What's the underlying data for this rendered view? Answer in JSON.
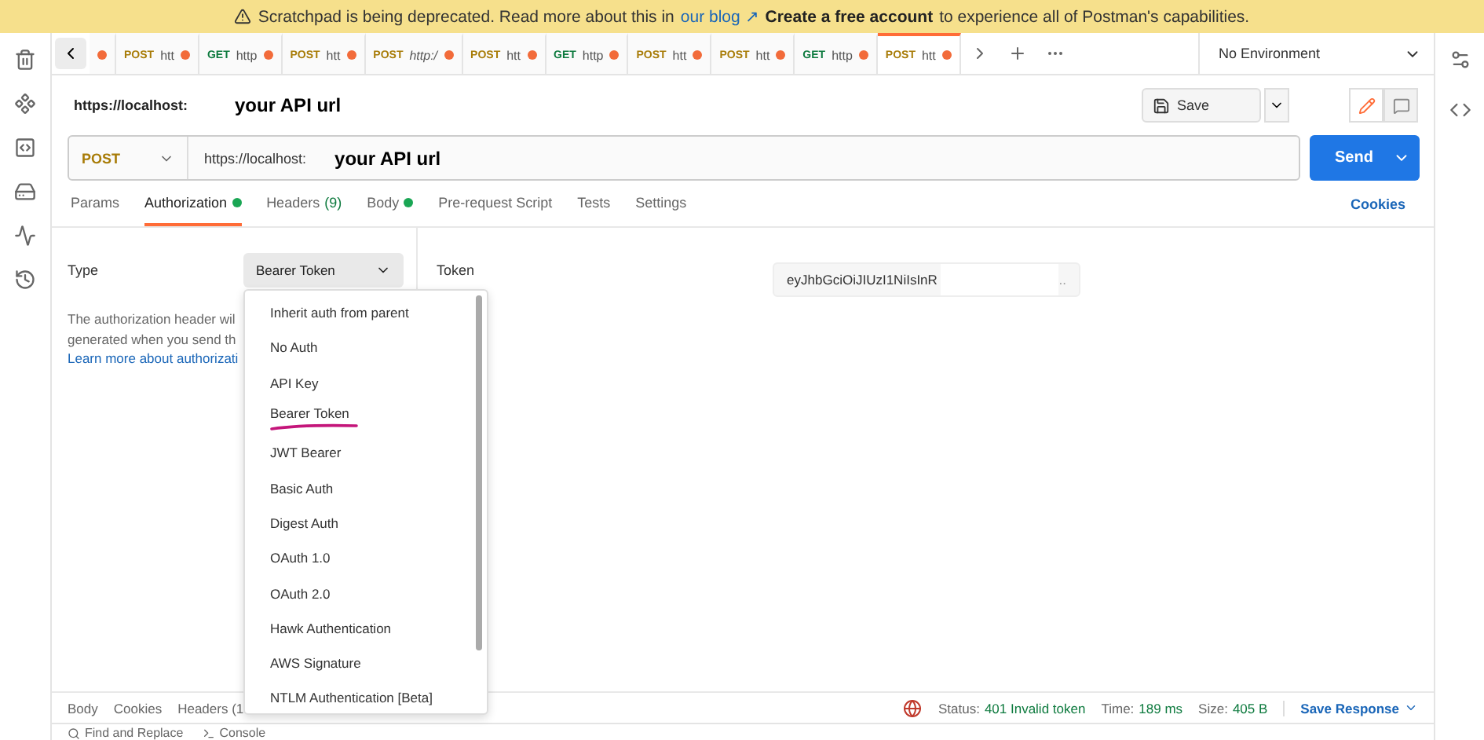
{
  "banner": {
    "text": "Scratchpad is being deprecated. Read more about this in",
    "link": "our blog ↗",
    "cta": "Create a free account",
    "rest": "to experience all of Postman's capabilities."
  },
  "tabs": [
    {
      "method": "POST",
      "label": "htt",
      "preview": false,
      "selected": false
    },
    {
      "method": "GET",
      "label": "http",
      "preview": false,
      "selected": false
    },
    {
      "method": "POST",
      "label": "htt",
      "preview": false,
      "selected": false
    },
    {
      "method": "POST",
      "label": "http:/",
      "preview": true,
      "selected": false
    },
    {
      "method": "POST",
      "label": "htt",
      "preview": false,
      "selected": false
    },
    {
      "method": "GET",
      "label": "http",
      "preview": false,
      "selected": false
    },
    {
      "method": "POST",
      "label": "htt",
      "preview": false,
      "selected": false
    },
    {
      "method": "POST",
      "label": "htt",
      "preview": false,
      "selected": false
    },
    {
      "method": "GET",
      "label": "http",
      "preview": false,
      "selected": false
    },
    {
      "method": "POST",
      "label": "htt",
      "preview": false,
      "selected": true
    }
  ],
  "environment": "No Environment",
  "request": {
    "name": "https://localhost:",
    "name_note": "your API url",
    "save": "Save",
    "method": "POST",
    "url": "https://localhost:",
    "url_note": "your API url",
    "send": "Send"
  },
  "request_tabs": [
    {
      "label": "Params",
      "dot": false,
      "selected": false
    },
    {
      "label": "Authorization",
      "dot": true,
      "selected": true
    },
    {
      "label": "Headers",
      "dot": false,
      "count": "(9)",
      "selected": false
    },
    {
      "label": "Body",
      "dot": true,
      "selected": false
    },
    {
      "label": "Pre-request Script",
      "dot": false,
      "selected": false
    },
    {
      "label": "Tests",
      "dot": false,
      "selected": false
    },
    {
      "label": "Settings",
      "dot": false,
      "selected": false
    }
  ],
  "cookies": "Cookies",
  "auth": {
    "type_label": "Type",
    "type_value": "Bearer Token",
    "help_1": "The authorization header wil",
    "help_2": "generated when you send th",
    "learn": "Learn more about authorizati",
    "token_label": "Token",
    "token_value": "eyJhbGciOiJIUzI1NiIsInR",
    "token_more": ".."
  },
  "dropdown": [
    {
      "label": "Inherit auth from parent",
      "marked": false
    },
    {
      "label": "No Auth",
      "marked": false
    },
    {
      "label": "API Key",
      "marked": false
    },
    {
      "label": "Bearer Token",
      "marked": true
    },
    {
      "label": "JWT Bearer",
      "marked": false
    },
    {
      "label": "Basic Auth",
      "marked": false
    },
    {
      "label": "Digest Auth",
      "marked": false
    },
    {
      "label": "OAuth 1.0",
      "marked": false
    },
    {
      "label": "OAuth 2.0",
      "marked": false
    },
    {
      "label": "Hawk Authentication",
      "marked": false
    },
    {
      "label": "AWS Signature",
      "marked": false
    },
    {
      "label": "NTLM Authentication [Beta]",
      "marked": false
    }
  ],
  "response": {
    "tabs": [
      "Body",
      "Cookies",
      "Headers (1"
    ],
    "status_label": "Status:",
    "status": "401 Invalid token",
    "time_label": "Time:",
    "time": "189 ms",
    "size_label": "Size:",
    "size": "405 B",
    "save": "Save Response"
  },
  "footer": [
    "Find and Replace",
    "Console"
  ]
}
